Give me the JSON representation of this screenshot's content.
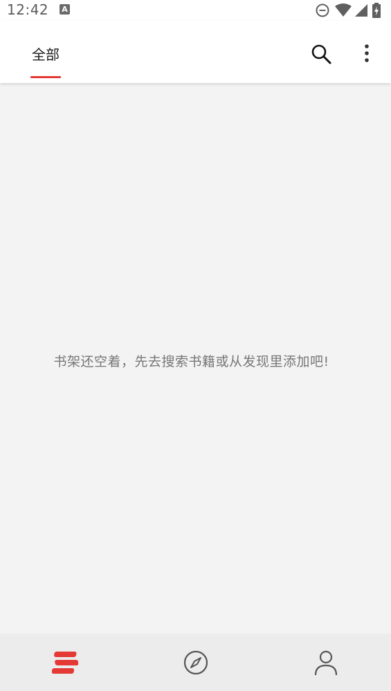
{
  "status_bar": {
    "time": "12:42",
    "app_icon_letter": "A",
    "icons": [
      "do-not-disturb-icon",
      "wifi-icon",
      "cellular-signal-icon",
      "battery-charging-icon"
    ]
  },
  "app_bar": {
    "tab_all_label": "全部",
    "accent_color": "#e53935"
  },
  "main": {
    "empty_message": "书架还空着，先去搜索书籍或从发现里添加吧!"
  },
  "bottom_nav": {
    "items": [
      {
        "icon": "bookshelf-icon",
        "active": true
      },
      {
        "icon": "compass-icon",
        "active": false
      },
      {
        "icon": "person-icon",
        "active": false
      }
    ]
  }
}
